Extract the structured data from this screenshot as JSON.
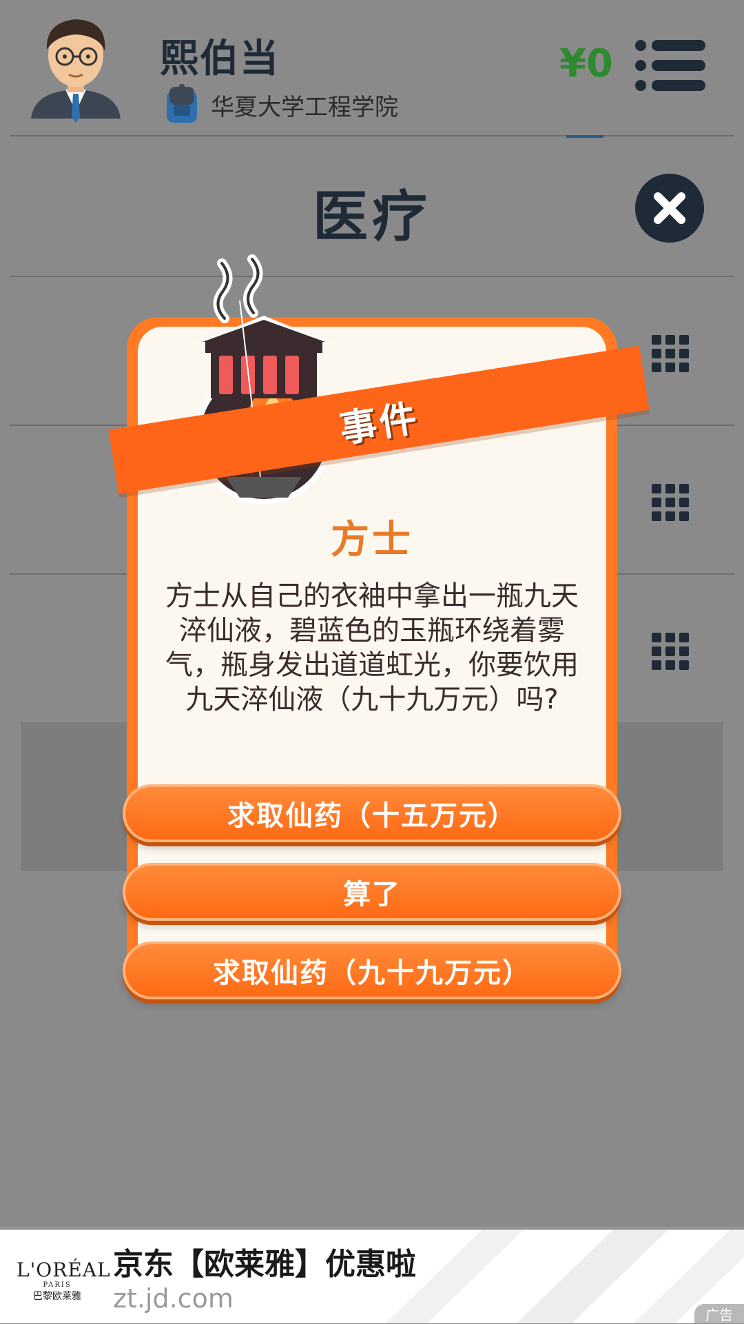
{
  "header": {
    "player_name": "熙伯当",
    "school": "华夏大学工程学院",
    "money": "¥0"
  },
  "page": {
    "title": "医疗"
  },
  "modal": {
    "banner": "事件",
    "event_title": "方士",
    "description": "方士从自己的衣袖中拿出一瓶九天淬仙液，碧蓝色的玉瓶环绕着雾气，瓶身发出道道虹光，你要饮用九天淬仙液（九十九万元）吗?",
    "choices": [
      {
        "label": "求取仙药（十五万元）"
      },
      {
        "label": "算了"
      },
      {
        "label": "求取仙药（九十九万元）"
      }
    ]
  },
  "ad": {
    "brand_line1": "L'ORÉAL",
    "brand_line2": "PARIS",
    "brand_line3": "巴黎欧莱雅",
    "title": "京东【欧莱雅】优惠啦",
    "url": "zt.jd.com",
    "badge": "广告"
  },
  "colors": {
    "accent_orange": "#ff6a14",
    "money_green": "#2f8a2f",
    "dark_navy": "#1f2a37"
  }
}
